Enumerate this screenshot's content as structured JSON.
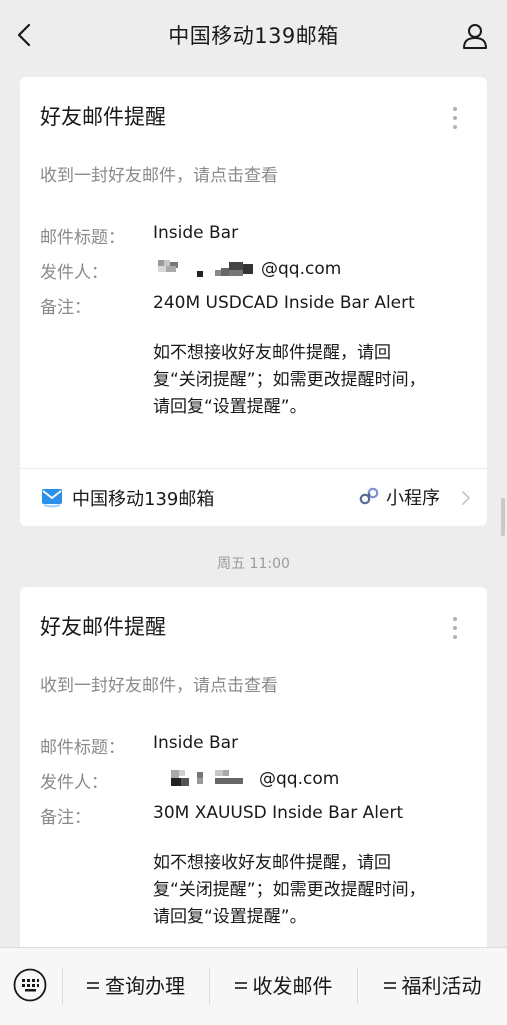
{
  "header": {
    "title": "中国移动139邮箱",
    "back_icon": "chevron-left-icon",
    "user_icon": "person-icon"
  },
  "cards": [
    {
      "title": "好友邮件提醒",
      "subtitle": "收到一封好友邮件，请点击查看",
      "subject_label": "邮件标题：",
      "subject_value": "Inside Bar",
      "sender_label": "发件人：",
      "sender_value": "@qq.com",
      "note_label": "备注：",
      "note_value": "240M USDCAD Inside Bar Alert",
      "notice_line1": "如不想接收好友邮件提醒，请回",
      "notice_line2": "复“关闭提醒”；如需更改提醒时间，",
      "notice_line3": "请回复“设置提醒”。",
      "footer_app": "中国移动139邮箱",
      "footer_type": "小程序"
    },
    {
      "title": "好友邮件提醒",
      "subtitle": "收到一封好友邮件，请点击查看",
      "subject_label": "邮件标题：",
      "subject_value": "Inside Bar",
      "sender_label": "发件人：",
      "sender_value": "@qq.com",
      "note_label": "备注：",
      "note_value": "30M XAUUSD Inside Bar Alert",
      "notice_line1": "如不想接收好友邮件提醒，请回",
      "notice_line2": "复“关闭提醒”；如需更改提醒时间，",
      "notice_line3": "请回复“设置提醒”。"
    }
  ],
  "timestamp": "周五 11:00",
  "bottom_menu": {
    "keyboard_icon": "keyboard-icon",
    "items": [
      {
        "label": "查询办理"
      },
      {
        "label": "收发邮件"
      },
      {
        "label": "福利活动"
      }
    ]
  },
  "colors": {
    "background": "#ededed",
    "card": "#ffffff",
    "secondary_text": "#8a8a8a",
    "mini_program_accent": "#576b95"
  }
}
